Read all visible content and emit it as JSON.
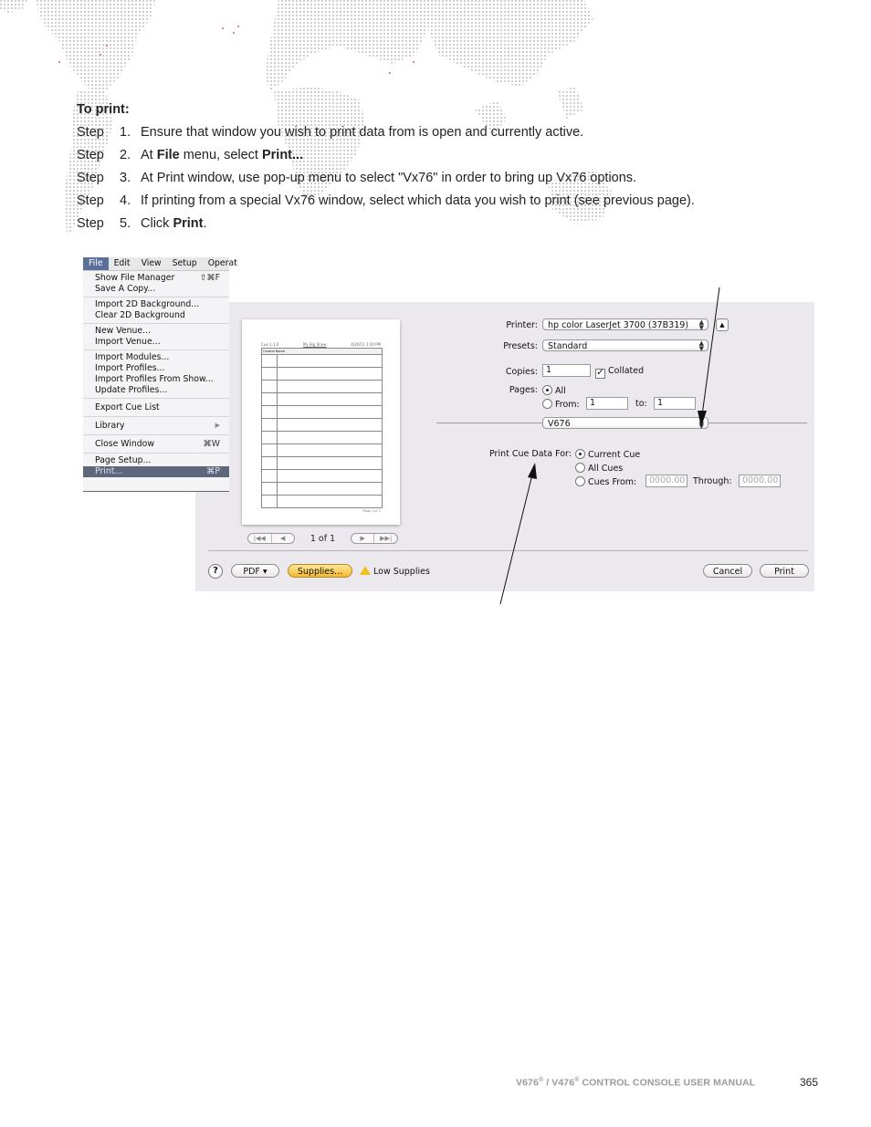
{
  "background": {
    "decoration": "dotted-world-map",
    "dot_color": "#c8c8c8",
    "accent_dot_color": "#e88080"
  },
  "instructions": {
    "heading": "To print:",
    "steps": [
      {
        "label": "Step",
        "number": "1.",
        "parts": [
          "Ensure that window you wish to print data from is open and currently active."
        ]
      },
      {
        "label": "Step",
        "number": "2.",
        "pre": "At ",
        "bold1": "File",
        "mid": " menu, select ",
        "bold2": "Print...",
        "post": ""
      },
      {
        "label": "Step",
        "number": "3.",
        "parts": [
          "At Print window, use pop-up menu to select \"Vx76\" in order to bring up Vx76 options."
        ]
      },
      {
        "label": "Step",
        "number": "4.",
        "parts": [
          "If printing from a special Vx76 window, select which data you wish to print (see previous page)."
        ]
      },
      {
        "label": "Step",
        "number": "5.",
        "pre": "Click ",
        "bold1": "Print",
        "post": "."
      }
    ]
  },
  "file_menu": {
    "menubar": [
      "File",
      "Edit",
      "View",
      "Setup",
      "Operat"
    ],
    "groups": [
      [
        {
          "label": "Show File Manager",
          "shortcut": "⇧⌘F"
        },
        {
          "label": "Save A Copy...",
          "shortcut": ""
        }
      ],
      [
        {
          "label": "Import 2D Background...",
          "shortcut": ""
        },
        {
          "label": "Clear 2D Background",
          "shortcut": ""
        }
      ],
      [
        {
          "label": "New Venue...",
          "shortcut": ""
        },
        {
          "label": "Import Venue...",
          "shortcut": ""
        }
      ],
      [
        {
          "label": "Import Modules...",
          "shortcut": ""
        },
        {
          "label": "Import Profiles...",
          "shortcut": ""
        },
        {
          "label": "Import Profiles From Show...",
          "shortcut": ""
        },
        {
          "label": "Update Profiles...",
          "shortcut": ""
        }
      ],
      [
        {
          "label": "Export Cue List",
          "shortcut": ""
        }
      ],
      [
        {
          "label": "Library",
          "shortcut": "▶"
        }
      ],
      [
        {
          "label": "Close Window",
          "shortcut": "⌘W"
        }
      ],
      [
        {
          "label": "Page Setup...",
          "shortcut": ""
        },
        {
          "label": "Print...",
          "shortcut": "⌘P",
          "selected": true
        }
      ]
    ]
  },
  "print_dialog": {
    "preview": {
      "header_left": "Cue 1.1.0",
      "header_center": "My Big Show",
      "header_right": "4/20/11 1:30 PM",
      "column_header": "Control Name",
      "footer": "Page 1 of 1",
      "page_count": "1 of 1"
    },
    "printer_label": "Printer:",
    "printer_value": "hp color LaserJet 3700 (37B319)",
    "presets_label": "Presets:",
    "presets_value": "Standard",
    "copies_label": "Copies:",
    "copies_value": "1",
    "collated_label": "Collated",
    "collated_checked": true,
    "pages_label": "Pages:",
    "pages_all_label": "All",
    "pages_from_label": "From:",
    "pages_from_value": "1",
    "pages_to_label": "to:",
    "pages_to_value": "1",
    "pages_selected": "All",
    "panel_popup_value": "V676",
    "cue_data_label": "Print Cue Data For:",
    "cue_options": [
      "Current Cue",
      "All Cues",
      "Cues From:"
    ],
    "cue_selected": "Current Cue",
    "cues_from_value": "0000.00",
    "through_label": "Through:",
    "through_value": "0000.00",
    "help_label": "?",
    "pdf_label": "PDF ▾",
    "supplies_label": "Supplies...",
    "low_supplies_label": "Low Supplies",
    "cancel_label": "Cancel",
    "print_label": "Print"
  },
  "footer": {
    "manual_title_a": "V676",
    "reg": "®",
    "manual_title_b": " / V476",
    "manual_title_c": " CONTROL CONSOLE USER MANUAL",
    "page_number": "365"
  }
}
